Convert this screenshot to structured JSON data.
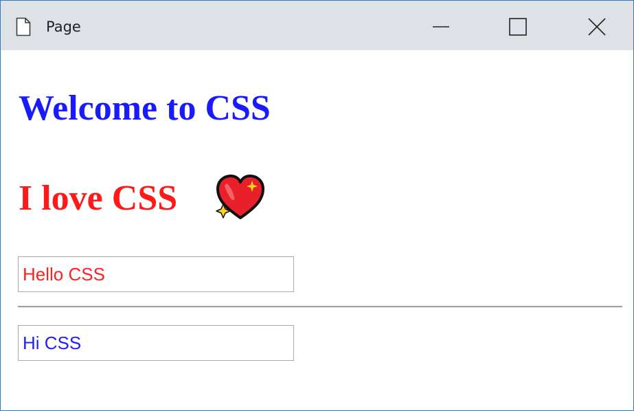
{
  "window": {
    "title": "Page",
    "icons": {
      "page": "page-icon",
      "minimize": "minimize-icon",
      "maximize": "maximize-icon",
      "close": "close-icon"
    }
  },
  "content": {
    "heading_welcome": "Welcome to CSS",
    "heading_love": "I love CSS",
    "emoji": "sparkling-heart-icon",
    "input_hello": {
      "value": "Hello CSS"
    },
    "input_hi": {
      "value": "Hi CSS"
    }
  },
  "colors": {
    "titlebar": "#dee1e6",
    "heading_welcome": "#1a1aff",
    "heading_love": "#ff1a1a",
    "input_hello_text": "#ff2020",
    "input_hi_text": "#2020ff",
    "window_border": "#2b78c5"
  }
}
